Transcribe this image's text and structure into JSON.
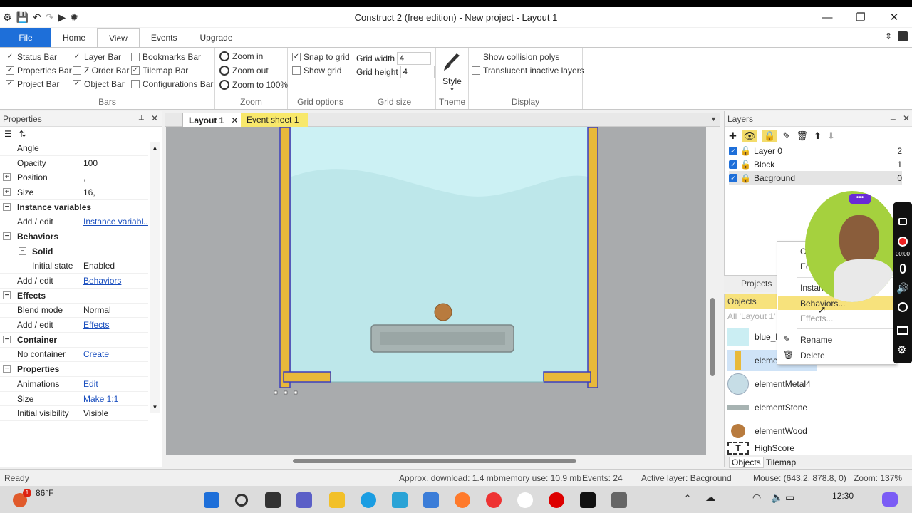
{
  "window": {
    "title": "Construct 2  (free edition) - New project - Layout 1"
  },
  "ribbon_tabs": [
    {
      "label": "File"
    },
    {
      "label": "Home"
    },
    {
      "label": "View"
    },
    {
      "label": "Events"
    },
    {
      "label": "Upgrade"
    }
  ],
  "ribbon": {
    "bars": {
      "label": "Bars",
      "items": [
        {
          "label": "Status Bar",
          "checked": true
        },
        {
          "label": "Properties Bar",
          "checked": true
        },
        {
          "label": "Project Bar",
          "checked": true
        },
        {
          "label": "Layer Bar",
          "checked": true
        },
        {
          "label": "Z Order Bar",
          "checked": false
        },
        {
          "label": "Object Bar",
          "checked": true
        },
        {
          "label": "Bookmarks Bar",
          "checked": false
        },
        {
          "label": "Tilemap Bar",
          "checked": true
        },
        {
          "label": "Configurations Bar",
          "checked": false
        }
      ]
    },
    "zoom": {
      "label": "Zoom",
      "zoom_in": "Zoom in",
      "zoom_out": "Zoom out",
      "zoom_100": "Zoom to 100%"
    },
    "grid_options": {
      "label": "Grid options",
      "snap": "Snap to grid",
      "snap_checked": true,
      "show": "Show grid",
      "show_checked": false
    },
    "grid_size": {
      "label": "Grid size",
      "width_label": "Grid width",
      "width_value": "4",
      "height_label": "Grid height",
      "height_value": "4"
    },
    "theme": {
      "label": "Theme",
      "style": "Style"
    },
    "display": {
      "label": "Display",
      "collision": "Show collision polys",
      "translucent": "Translucent inactive layers"
    }
  },
  "properties": {
    "title": "Properties",
    "rows": [
      {
        "type": "prop",
        "key": "Angle",
        "value": ""
      },
      {
        "type": "prop",
        "key": "Opacity",
        "value": "100"
      },
      {
        "type": "propx",
        "key": "Position",
        "value": ","
      },
      {
        "type": "propx",
        "key": "Size",
        "value": "16,"
      },
      {
        "type": "cat",
        "key": "Instance variables"
      },
      {
        "type": "link",
        "key": "Add / edit",
        "value": "Instance variabl..."
      },
      {
        "type": "cat",
        "key": "Behaviors"
      },
      {
        "type": "sub",
        "key": "Solid"
      },
      {
        "type": "prop2",
        "key": "Initial state",
        "value": "Enabled"
      },
      {
        "type": "link",
        "key": "Add / edit",
        "value": "Behaviors"
      },
      {
        "type": "cat",
        "key": "Effects"
      },
      {
        "type": "prop",
        "key": "Blend mode",
        "value": "Normal"
      },
      {
        "type": "link",
        "key": "Add / edit",
        "value": "Effects"
      },
      {
        "type": "cat",
        "key": "Container"
      },
      {
        "type": "link",
        "key": "No container",
        "value": "Create"
      },
      {
        "type": "cat",
        "key": "Properties"
      },
      {
        "type": "link",
        "key": "Animations",
        "value": "Edit"
      },
      {
        "type": "link",
        "key": "Size",
        "value": "Make 1:1"
      },
      {
        "type": "prop",
        "key": "Initial visibility",
        "value": "Visible"
      }
    ]
  },
  "doc_tabs": [
    {
      "label": "Layout 1"
    },
    {
      "label": "Event sheet 1"
    }
  ],
  "layers": {
    "title": "Layers",
    "rows": [
      {
        "name": "Layer 0",
        "index": "2",
        "locked": false
      },
      {
        "name": "Block",
        "index": "1",
        "locked": false
      },
      {
        "name": "Bacground",
        "index": "0",
        "locked": true
      }
    ]
  },
  "projects_tab": "Projects",
  "objects": {
    "title": "Objects",
    "filter": "All 'Layout 1'",
    "items": [
      {
        "name": "blue_la"
      },
      {
        "name": "element"
      },
      {
        "name": "elementMetal4"
      },
      {
        "name": "elementStone"
      },
      {
        "name": "elementWood"
      },
      {
        "name": "HighScore"
      }
    ],
    "bottom_tabs": [
      {
        "label": "Objects"
      },
      {
        "label": "Tilemap"
      }
    ]
  },
  "context_menu": {
    "items": [
      {
        "label": "C"
      },
      {
        "label": "Ed"
      },
      {
        "label": "Instan"
      },
      {
        "label": "Behaviors..."
      },
      {
        "label": "Effects..."
      },
      {
        "label": "Rename"
      },
      {
        "label": "Delete"
      }
    ]
  },
  "status_bar": {
    "ready": "Ready",
    "download": "Approx. download: 1.4 mb",
    "memory": "memory use: 10.9 mb",
    "events": "Events: 24",
    "active_layer": "Active layer: Bacground",
    "mouse": "Mouse: (643.2, 878.8, 0)",
    "zoom": "Zoom: 137%"
  },
  "taskbar": {
    "weather": "86°F",
    "time": "12:30",
    "notification_count": "1"
  },
  "recorder": {
    "timer": "00:00"
  }
}
